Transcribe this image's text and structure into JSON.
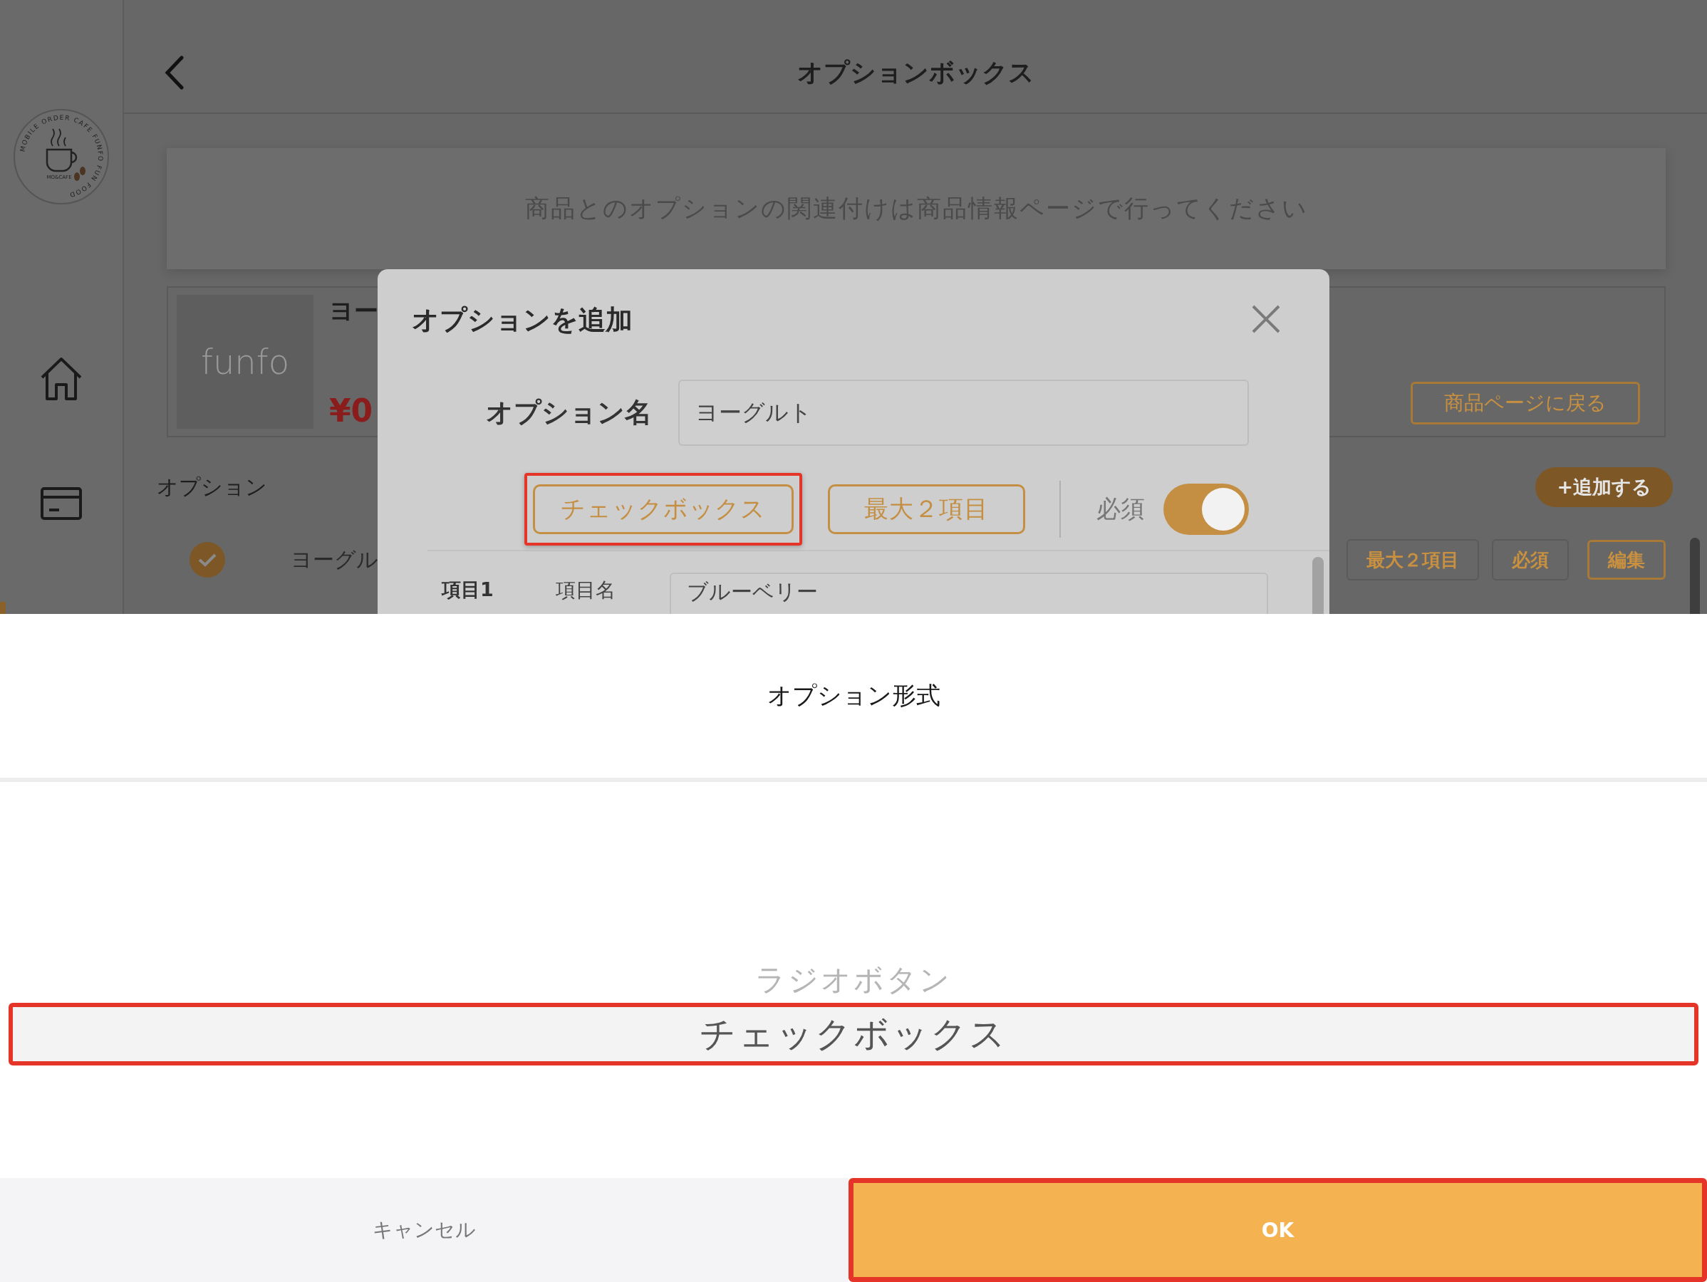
{
  "logo": {
    "ring_text": "MOBILE ORDER CAFE FUNFO FUN FOOD",
    "center_text": "MO&CAFE"
  },
  "header": {
    "title": "オプションボックス"
  },
  "notice": "商品とのオプションの関連付けは商品情報ページで行ってください",
  "product": {
    "name": "ヨー",
    "price": "¥0",
    "image_text": "funfo",
    "back_button": "商品ページに戻る"
  },
  "options_section": {
    "label": "オプション",
    "add_button": "+追加する",
    "rows": [
      {
        "name": "ヨーグル",
        "checked": true,
        "tags": [
          "最大２項目",
          "必須"
        ],
        "edit_button": "編集"
      }
    ]
  },
  "dialog": {
    "title": "オプションを追加",
    "name_label": "オプション名",
    "name_value": "ヨーグルト",
    "type_button": {
      "label": "チェックボックス",
      "highlighted": true
    },
    "max_button": "最大２項目",
    "required_label": "必須",
    "required": true,
    "items": [
      {
        "label": "項目1",
        "field_label": "項目名",
        "value": "ブルーベリー"
      }
    ]
  },
  "picker": {
    "title": "オプション形式",
    "options": [
      {
        "label": "ラジオボタン",
        "selected": false,
        "highlighted": false
      },
      {
        "label": "チェックボックス",
        "selected": true,
        "highlighted": true
      }
    ],
    "cancel_button": {
      "label": "キャンセル",
      "highlighted": false
    },
    "ok_button": {
      "label": "OK",
      "highlighted": true
    }
  }
}
